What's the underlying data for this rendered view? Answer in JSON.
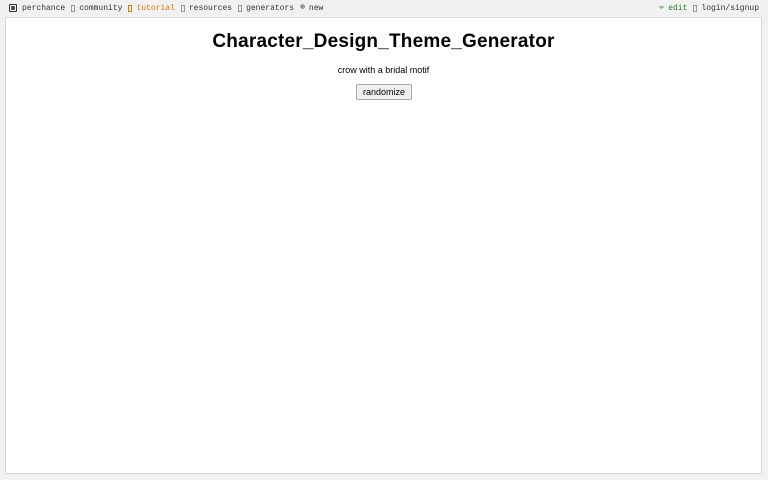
{
  "topbar": {
    "left_items": [
      {
        "label": "perchance",
        "icon": "dice-icon"
      },
      {
        "label": "community",
        "icon": "chat-icon"
      },
      {
        "label": "tutorial",
        "icon": "book-icon"
      },
      {
        "label": "resources",
        "icon": "box-icon"
      },
      {
        "label": "generators",
        "icon": "box-icon"
      },
      {
        "label": "new",
        "icon": "plus-circle-icon"
      }
    ],
    "right_items": [
      {
        "label": "edit",
        "icon": "pencil-icon"
      },
      {
        "label": "login/signup",
        "icon": "user-icon"
      }
    ],
    "colors": {
      "tutorial": "#e07b00",
      "edit": "#1a8a1a"
    }
  },
  "main": {
    "title": "Character_Design_Theme_Generator",
    "output": "crow with a bridal motif",
    "randomize_label": "randomize"
  }
}
